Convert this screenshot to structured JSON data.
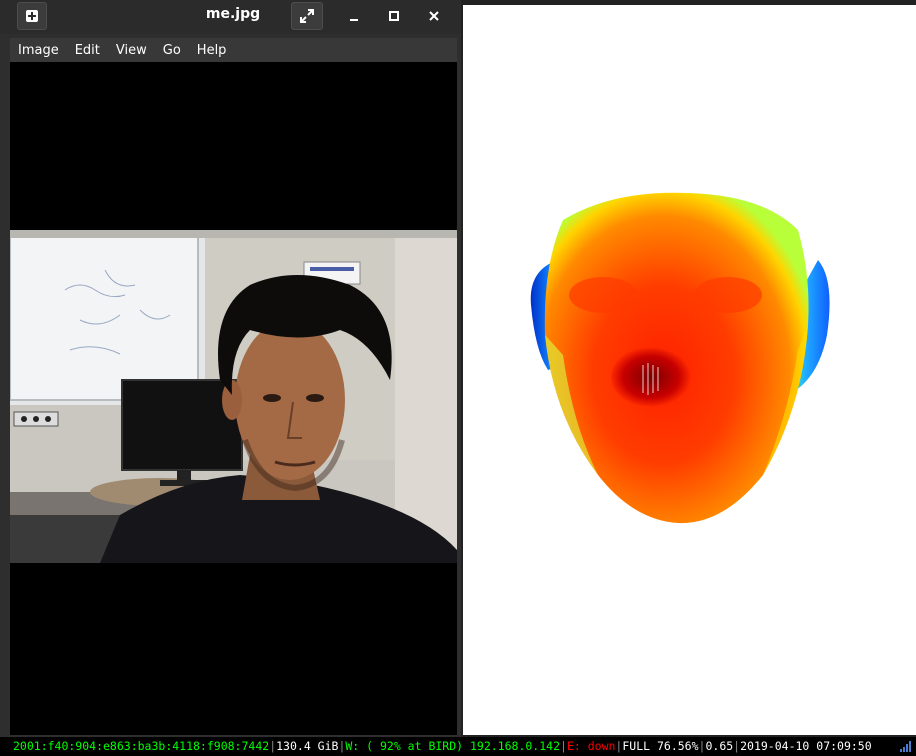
{
  "viewer_window": {
    "title": "me.jpg",
    "menu": [
      "Image",
      "Edit",
      "View",
      "Go",
      "Help"
    ],
    "buttons": {
      "new": "new-tab-icon",
      "fullscreen": "fullscreen-icon",
      "minimize": "minimize-icon",
      "maximize": "maximize-icon",
      "close": "close-icon"
    }
  },
  "render_window": {
    "content": "3d-face-heatmap-render",
    "background": "#ffffff"
  },
  "statusbar": {
    "ipv6": "2001:f40:904:e863:ba3b:4118:f908:7442",
    "disk": "130.4 GiB",
    "wifi": "W: ( 92% at BIRD) 192.168.0.142",
    "ethernet": "E: down",
    "battery": "FULL 76.56%",
    "load": "0.65",
    "datetime": "2019-04-10 07:09:50",
    "colors": {
      "ok": "#00ff00",
      "bad": "#ff0000",
      "neutral": "#ffffff"
    }
  }
}
